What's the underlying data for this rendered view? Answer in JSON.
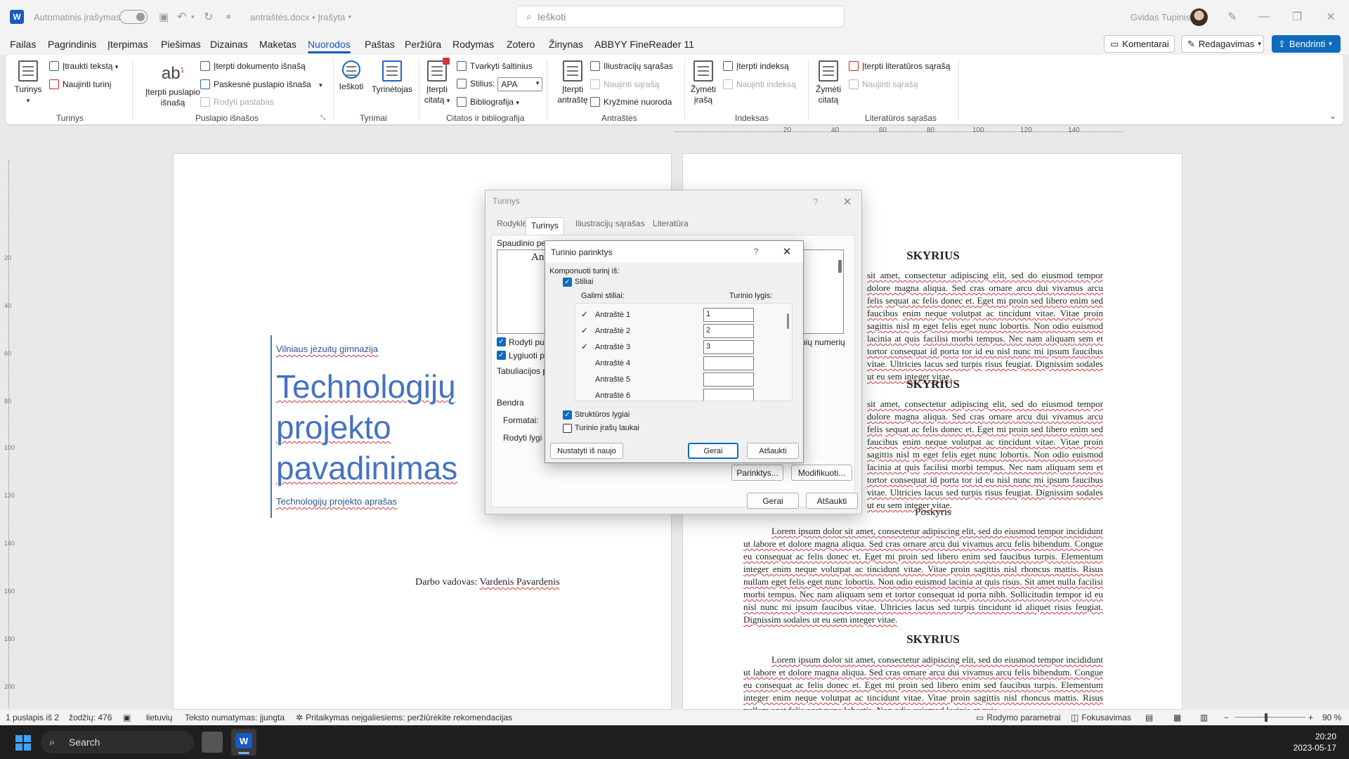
{
  "titlebar": {
    "app_logo": "W",
    "autosave_label": "Automatinis įrašymas",
    "doc_title": "antraštės.docx • Įrašyta",
    "search_placeholder": "Ieškoti",
    "user_name": "Gvidas Tupinis"
  },
  "menu": {
    "tabs": [
      "Failas",
      "Pagrindinis",
      "Įterpimas",
      "Piešimas",
      "Dizainas",
      "Maketas",
      "Nuorodos",
      "Paštas",
      "Peržiūra",
      "Rodymas",
      "Zotero",
      "Žinynas",
      "ABBYY FineReader 11"
    ],
    "active_tab": "Nuorodos",
    "comments": "Komentarai",
    "editing": "Redagavimas",
    "share": "Bendrinti"
  },
  "ribbon": {
    "turinys": {
      "big": "Turinys",
      "add_text": "Įtraukti tekstą",
      "update": "Naujinti turinį",
      "group": "Turinys"
    },
    "footnotes": {
      "big": "Įterpti puslapio išnašą",
      "insert_end": "Įterpti dokumento išnašą",
      "next": "Paskesnė puslapio išnaša",
      "show": "Rodyti pastabas",
      "group": "Puslapio išnašos"
    },
    "research": {
      "search": "Ieškoti",
      "researcher": "Tyrinėtojas",
      "group": "Tyrimai"
    },
    "citations": {
      "big": "Įterpti citatą",
      "manage": "Tvarkyti šaltinius",
      "style_label": "Stilius:",
      "style_value": "APA",
      "bib": "Bibliografija",
      "group": "Citatos ir bibliografija"
    },
    "captions": {
      "big": "Įterpti antraštę",
      "illus": "Iliustracijų sąrašas",
      "update": "Naujinti sąrašą",
      "cross": "Kryžminė nuoroda",
      "group": "Antraštės"
    },
    "index": {
      "big": "Žymėti įrašą",
      "insert": "Įterpti indeksą",
      "update": "Naujinti indeksą",
      "group": "Indeksas"
    },
    "toa": {
      "big": "Žymėti citatą",
      "insert": "Įterpti literatūros sąrašą",
      "update": "Naujinti sąrašą",
      "group": "Literatūros sąrašas"
    }
  },
  "ruler": {
    "h": [
      "20",
      "40",
      "60",
      "80",
      "100",
      "120",
      "140"
    ],
    "v": [
      "20",
      "40",
      "60",
      "80",
      "100",
      "120",
      "140",
      "160",
      "180",
      "200"
    ]
  },
  "cover": {
    "school": "Vilniaus jėzuitų gimnazija",
    "title": "Technologijų projekto pavadinimas",
    "subtitle": "Technologijų projekto aprašas",
    "supervisor_label": "Darbo vadovas:",
    "supervisor_name": "Vardenis Pavardenis"
  },
  "doc": {
    "heading": "SKYRIUS",
    "partial_heading": "Poskyris",
    "frag1": "sit amet, consectetur adipiscing elit, sed do eiusmod tempor",
    "frag2": "dolore magna aliqua. Sed cras ornare arcu dui vivamus arcu felis",
    "frag3": "sequat ac felis donec et. Eget mi proin sed libero enim sed faucibus",
    "frag4": "enim neque volutpat ac tincidunt vitae. Vitae proin sagittis nisl",
    "frag5": "m eget felis eget nunc lobortis. Non odio euismod lacinia at quis",
    "frag6": "facilisi morbi tempus. Nec nam aliquam sem et tortor consequat id porta",
    "frag7": "tor id eu nisl nunc mi ipsum faucibus vitae. Ultricies lacus sed turpis",
    "frag8": "risus feugiat. Dignissim sodales ut eu sem integer vitae.",
    "para_full": "Lorem ipsum dolor sit amet, consectetur adipiscing elit, sed do eiusmod tempor incididunt ut labore et dolore magna aliqua. Sed cras ornare arcu dui vivamus arcu felis bibendum. Congue eu consequat ac felis donec et. Eget mi proin sed libero enim sed faucibus turpis. Elementum integer enim neque volutpat ac tincidunt vitae. Vitae proin sagittis nisl rhoncus mattis. Risus nullam eget felis eget nunc lobortis. Non odio euismod lacinia at quis risus. Sit amet nulla facilisi morbi tempus. Nec nam aliquam sem et tortor consequat id porta nibh. Sollicitudin tempor id eu nisl nunc mi ipsum faucibus vitae. Ultricies lacus sed turpis tincidunt id aliquet risus feugiat. Dignissim sodales ut eu sem integer vitae.",
    "para_cut": "Lorem ipsum dolor sit amet, consectetur adipiscing elit, sed do eiusmod tempor incididunt ut labore et dolore magna aliqua. Sed cras ornare arcu dui vivamus arcu felis bibendum. Congue eu consequat ac felis donec et. Eget mi proin sed libero enim sed faucibus turpis. Elementum integer enim neque volutpat ac tincidunt vitae. Vitae proin sagittis nisl rhoncus mattis. Risus nullam eget felis eget nunc lobortis. Non odio euismod lacinia at quis"
  },
  "outer_dialog": {
    "title": "Turinys",
    "help": "?",
    "close": "✕",
    "tabs": [
      "Rodyklė",
      "Turinys",
      "Iliustracijų sąrašas",
      "Literatūra"
    ],
    "active_tab": "Turinys",
    "print_preview": "Spaudinio pe",
    "preview_a1": "An",
    "preview_a2": "A",
    "show_page": "Rodyti pus",
    "align_right": "Lygiuoti p",
    "tab_leader": "Tabuliacijos p",
    "web_numbers": "pių numerių",
    "general": "Bendra",
    "formats": "Formatai:",
    "show_levels": "Rodyti lygi",
    "options_btn": "Parinktys...",
    "modify_btn": "Modifikuoti...",
    "ok": "Gerai",
    "cancel": "Atšaukti"
  },
  "inner_dialog": {
    "title": "Turinio parinktys",
    "help": "?",
    "close": "✕",
    "build_from": "Komponuoti turinį iš:",
    "styles": "Stiliai",
    "avail_styles": "Galimi stiliai:",
    "toc_level": "Turinio lygis:",
    "levels": [
      {
        "name": "Antraštė 1",
        "checked": "✓",
        "level": "1"
      },
      {
        "name": "Antraštė 2",
        "checked": "✓",
        "level": "2"
      },
      {
        "name": "Antraštė 3",
        "checked": "✓",
        "level": "3"
      },
      {
        "name": "Antraštė 4",
        "checked": "",
        "level": ""
      },
      {
        "name": "Antraštė 5",
        "checked": "",
        "level": ""
      },
      {
        "name": "Antraštė 6",
        "checked": "",
        "level": ""
      }
    ],
    "outline": "Struktūros lygiai",
    "entry_fields": "Turinio įrašų laukai",
    "reset": "Nustatyti iš naujo",
    "ok": "Gerai",
    "cancel": "Atšaukti"
  },
  "status": {
    "page": "1 puslapis iš 2",
    "words": "žodžių: 476",
    "language": "lietuvių",
    "prediction": "Teksto numatymas: įjungta",
    "accessibility": "Pritaikymas neįgaliesiems: peržiūrėkite rekomendacijas",
    "display": "Rodymo parametrai",
    "focus": "Fokusavimas",
    "zoom": "90 %"
  },
  "taskbar": {
    "search": "Search",
    "time": "20:20",
    "date": "2023-05-17"
  },
  "colors": {
    "accent": "#185abd",
    "title_blue": "#4472c4",
    "checkbox": "#0f6cbd"
  }
}
